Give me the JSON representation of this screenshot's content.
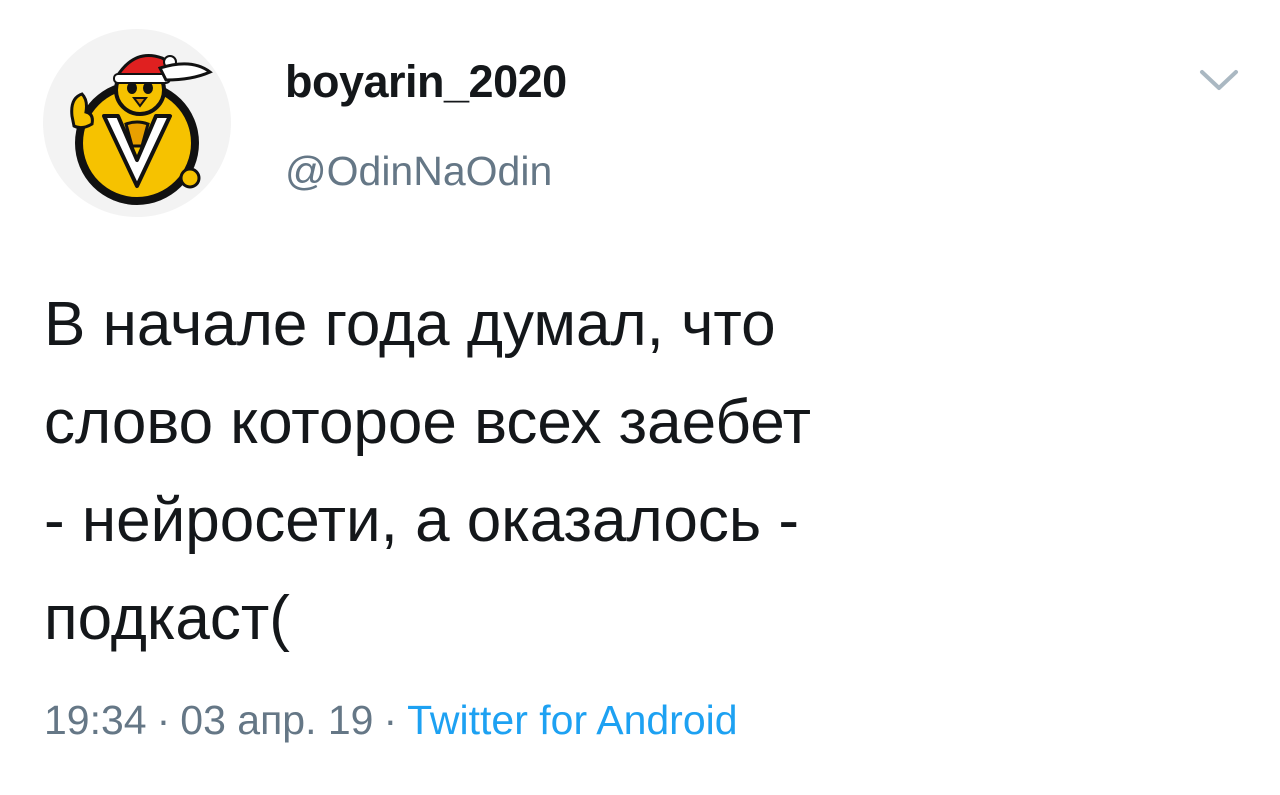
{
  "tweet": {
    "author": {
      "display_name": "boyarin_2020",
      "handle": "@OdinNaOdin",
      "avatar_icon": "yellow-bird-santa-hat-avatar"
    },
    "menu_icon": "chevron-down-icon",
    "text": "В начале года думал, что\nслово которое всех заебет\n- нейросети, а оказалось -\nподкаст(",
    "meta": {
      "time": "19:34",
      "separator": "·",
      "date": "03 апр. 19",
      "source": "Twitter for Android"
    }
  },
  "colors": {
    "text_primary": "#14171a",
    "text_secondary": "#657786",
    "link": "#1da1f2",
    "avatar_yellow": "#f6c200",
    "avatar_bg": "#f2f2f2"
  }
}
